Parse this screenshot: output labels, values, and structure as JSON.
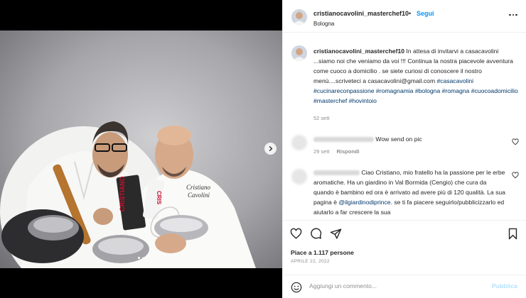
{
  "post": {
    "username": "cristianocavolini_masterchef10",
    "follow_label": "Segui",
    "separator": "•",
    "location": "Bologna",
    "more_icon": "more-horizontal-icon"
  },
  "media": {
    "apron_text_1": "Cristiano",
    "apron_text_2": "Cavolini",
    "box_text": "CRISTIANO",
    "box_text_2": "CRIS",
    "next_icon": "chevron-right-icon"
  },
  "caption": {
    "username": "cristianocavolini_masterchef10",
    "text_1": " In attesa di invitarvi a casacavolini ...siamo noi che veniamo da voi !!! Continua la nostra piacevole avventura come cuoco a domicilio . se siete curiosi di conoscere il nostro menù....scriveteci a casacavolini@gmail.com ",
    "tags": [
      "#casacavolini",
      "#cucinareconpassione",
      "#romagnamia",
      "#bologna",
      "#romagna",
      "#cuocoadomicilio",
      "#masterchef",
      "#hovintoio"
    ],
    "time": "52 sett"
  },
  "comments": [
    {
      "text": "Wow send on pic",
      "time": "29 sett",
      "reply_label": "Rispondi"
    },
    {
      "text_1": " Ciao Cristiano, mio fratello ha la passione per le erbe aromatiche. Ha un giardino in Val Bormida (Cengio) che cura da quando è bambino ed ora è arrivato ad avere più di 120 qualità. La sua pagina è ",
      "mention": "@ilgiardinodiprince",
      "text_2": ". se ti fa piacere seguirlo/pubblicizzarlo ed aiutarlo a far crescere la sua"
    }
  ],
  "actions": {
    "like_icon": "heart-icon",
    "comment_icon": "comment-icon",
    "share_icon": "send-icon",
    "save_icon": "bookmark-icon",
    "likes": "Piace a 1.117 persone",
    "date": "APRILE 22, 2022"
  },
  "add_comment": {
    "placeholder": "Aggiungi un commento...",
    "publish_label": "Pubblica",
    "emoji_icon": "emoji-icon"
  },
  "colors": {
    "accent": "#0095f6",
    "hashtag": "#00376b",
    "muted": "#8e8e8e",
    "publish_disabled": "#b2dffc"
  }
}
